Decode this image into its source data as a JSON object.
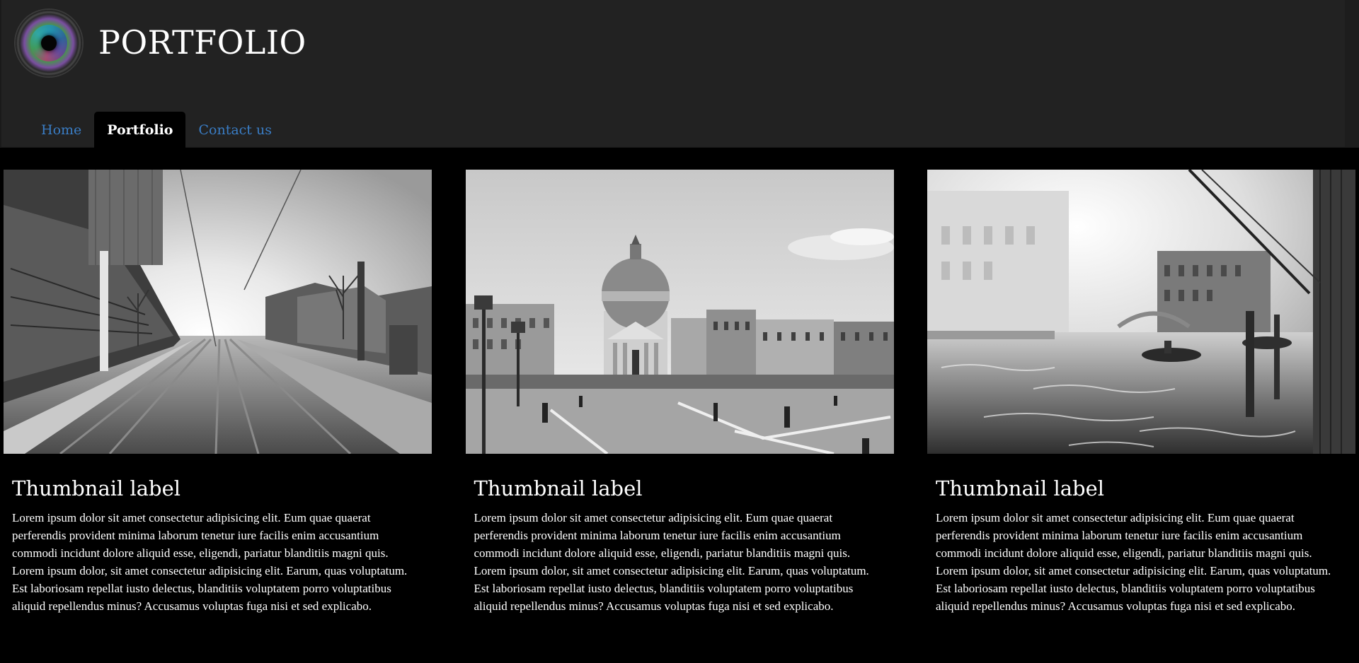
{
  "header": {
    "brand": "PORTFOLIO",
    "logo_icon": "camera-lens-icon"
  },
  "nav": {
    "items": [
      {
        "label": "Home",
        "active": false
      },
      {
        "label": "Portfolio",
        "active": true
      },
      {
        "label": "Contact us",
        "active": false
      }
    ]
  },
  "colors": {
    "header_bg": "#222222",
    "page_bg": "#000000",
    "link": "#3a7dc5",
    "text": "#ffffff"
  },
  "thumbnails": [
    {
      "title": "Thumbnail label",
      "text": "Lorem ipsum dolor sit amet consectetur adipisicing elit. Eum quae quaerat perferendis provident minima laborum tenetur iure facilis enim accusantium commodi incidunt dolore aliquid esse, eligendi, pariatur blanditiis magni quis. Lorem ipsum dolor, sit amet consectetur adipisicing elit. Earum, quas voluptatum. Est laboriosam repellat iusto delectus, blanditiis voluptatem porro voluptatibus aliquid repellendus minus? Accusamus voluptas fuga nisi et sed explicabo."
    },
    {
      "title": "Thumbnail label",
      "text": "Lorem ipsum dolor sit amet consectetur adipisicing elit. Eum quae quaerat perferendis provident minima laborum tenetur iure facilis enim accusantium commodi incidunt dolore aliquid esse, eligendi, pariatur blanditiis magni quis. Lorem ipsum dolor, sit amet consectetur adipisicing elit. Earum, quas voluptatum. Est laboriosam repellat iusto delectus, blanditiis voluptatem porro voluptatibus aliquid repellendus minus? Accusamus voluptas fuga nisi et sed explicabo."
    },
    {
      "title": "Thumbnail label",
      "text": "Lorem ipsum dolor sit amet consectetur adipisicing elit. Eum quae quaerat perferendis provident minima laborum tenetur iure facilis enim accusantium commodi incidunt dolore aliquid esse, eligendi, pariatur blanditiis magni quis. Lorem ipsum dolor, sit amet consectetur adipisicing elit. Earum, quas voluptatum. Est laboriosam repellat iusto delectus, blanditiis voluptatem porro voluptatibus aliquid repellendus minus? Accusamus voluptas fuga nisi et sed explicabo."
    }
  ]
}
